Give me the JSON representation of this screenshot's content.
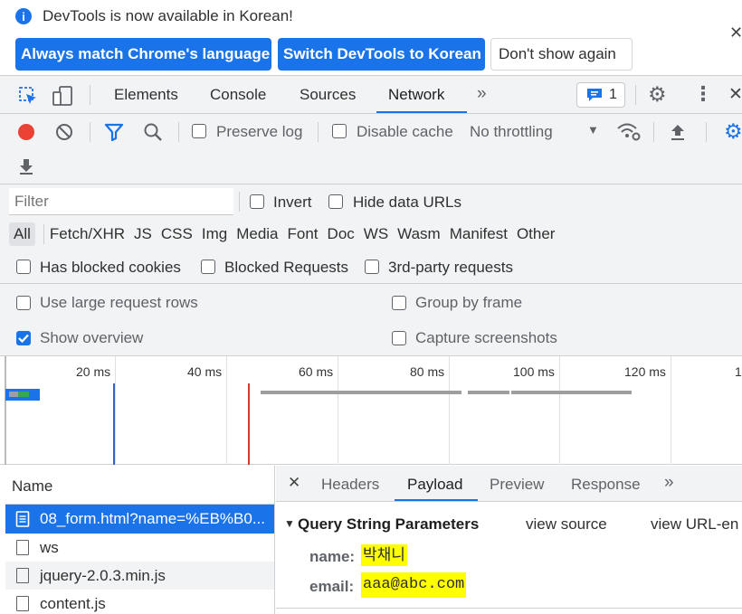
{
  "infobar": {
    "message": "DevTools is now available in Korean!",
    "btn_match": "Always match Chrome's language",
    "btn_switch": "Switch DevTools to Korean",
    "btn_dont_show": "Don't show again"
  },
  "main_tabs": {
    "elements": "Elements",
    "console": "Console",
    "sources": "Sources",
    "network": "Network",
    "issues_count": "1"
  },
  "network_toolbar": {
    "preserve_log": "Preserve log",
    "disable_cache": "Disable cache",
    "throttling": "No throttling"
  },
  "filter_bar": {
    "placeholder": "Filter",
    "invert": "Invert",
    "hide_data_urls": "Hide data URLs"
  },
  "type_filters": [
    "All",
    "Fetch/XHR",
    "JS",
    "CSS",
    "Img",
    "Media",
    "Font",
    "Doc",
    "WS",
    "Wasm",
    "Manifest",
    "Other"
  ],
  "blocked_filters": {
    "has_blocked_cookies": "Has blocked cookies",
    "blocked_requests": "Blocked Requests",
    "third_party": "3rd-party requests"
  },
  "settings": {
    "large_rows": "Use large request rows",
    "group_by_frame": "Group by frame",
    "show_overview": "Show overview",
    "show_overview_checked": true,
    "capture_screenshots": "Capture screenshots"
  },
  "overview": {
    "ticks": [
      "20 ms",
      "40 ms",
      "60 ms",
      "80 ms",
      "100 ms",
      "120 ms",
      "1"
    ]
  },
  "request_list": {
    "header": "Name",
    "items": [
      {
        "name": "08_form.html?name=%EB%B0...",
        "selected": true
      },
      {
        "name": "ws",
        "selected": false
      },
      {
        "name": "jquery-2.0.3.min.js",
        "selected": false
      },
      {
        "name": "content.js",
        "selected": false
      }
    ]
  },
  "detail_tabs": {
    "headers": "Headers",
    "payload": "Payload",
    "preview": "Preview",
    "response": "Response"
  },
  "payload": {
    "section_title": "Query String Parameters",
    "view_source": "view source",
    "view_url_encoded": "view URL-en",
    "params": [
      {
        "key": "name:",
        "value": "박채니"
      },
      {
        "key": "email:",
        "value": "aaa@abc.com"
      }
    ]
  },
  "colors": {
    "accent": "#1a73e8",
    "record": "#ea4335",
    "highlight": "#ffff00"
  }
}
